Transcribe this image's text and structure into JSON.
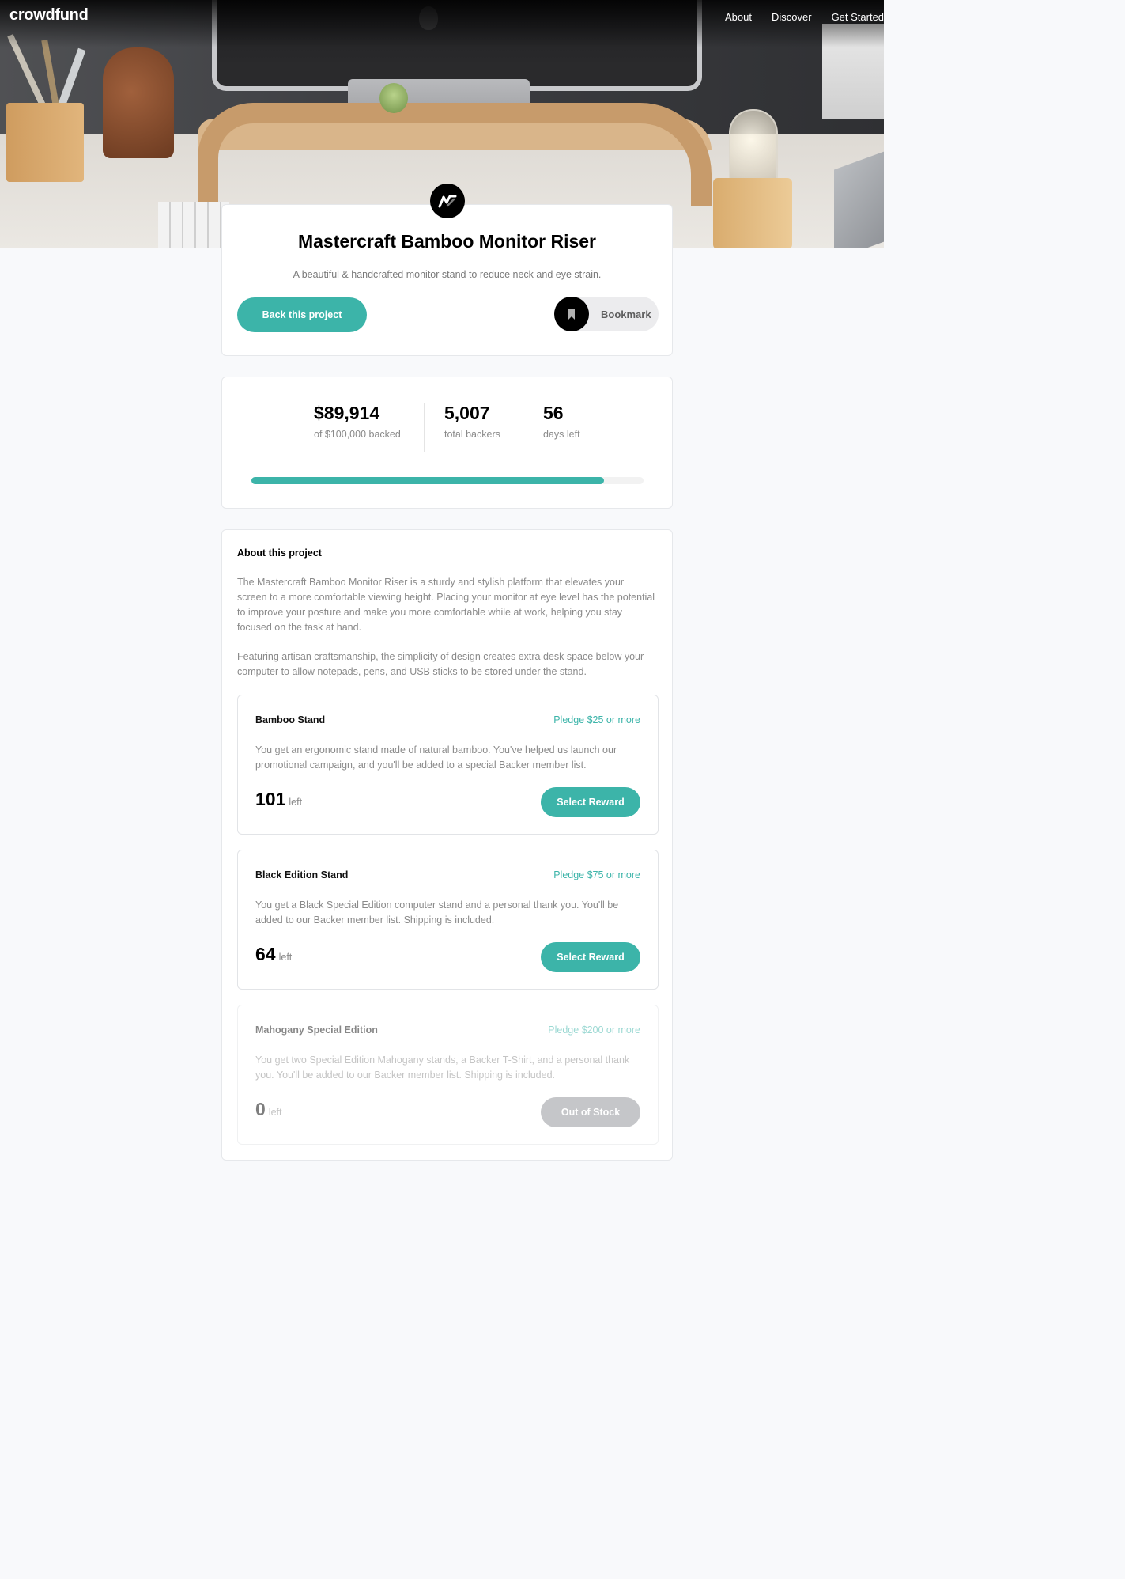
{
  "header": {
    "logo": "crowdfund",
    "nav": [
      "About",
      "Discover",
      "Get Started"
    ]
  },
  "project": {
    "title": "Mastercraft Bamboo Monitor Riser",
    "subtitle": "A beautiful & handcrafted monitor stand to reduce neck and eye strain.",
    "back_label": "Back this project",
    "bookmark_label": "Bookmark"
  },
  "stats": {
    "backed_amount": "$89,914",
    "backed_label": "of $100,000 backed",
    "backers": "5,007",
    "backers_label": "total backers",
    "days": "56",
    "days_label": "days left",
    "progress_fraction": 0.899
  },
  "about": {
    "title": "About this project",
    "paragraphs": [
      "The Mastercraft Bamboo Monitor Riser is a sturdy and stylish platform that elevates your screen to a more comfortable viewing height. Placing your monitor at eye level has the potential to improve your posture and make you more comfortable while at work, helping you stay focused on the task at hand.",
      "Featuring artisan craftsmanship, the simplicity of design creates extra desk space below your computer to allow notepads, pens, and USB sticks to be stored under the stand."
    ]
  },
  "rewards": [
    {
      "name": "Bamboo Stand",
      "pledge": "Pledge $25 or more",
      "description": "You get an ergonomic stand made of natural bamboo. You've helped us launch our promotional campaign, and you'll be added to a special Backer member list.",
      "count": "101",
      "left_label": "left",
      "button": "Select Reward"
    },
    {
      "name": "Black Edition Stand",
      "pledge": "Pledge $75 or more",
      "description": "You get a Black Special Edition computer stand and a personal thank you. You'll be added to our Backer member list. Shipping is included.",
      "count": "64",
      "left_label": "left",
      "button": "Select Reward"
    },
    {
      "name": "Mahogany Special Edition",
      "pledge": "Pledge $200 or more",
      "description": "You get two Special Edition Mahogany stands, a Backer T-Shirt, and a personal thank you. You'll be added to our Backer member list. Shipping is included.",
      "count": "0",
      "left_label": "left",
      "button": "Out of Stock"
    }
  ],
  "colors": {
    "accent": "#3cb4a9",
    "background": "#f8f9fb",
    "disabled": "#8c8f94"
  },
  "icons": [
    "mastercraft-logo-icon",
    "bookmark-icon"
  ]
}
